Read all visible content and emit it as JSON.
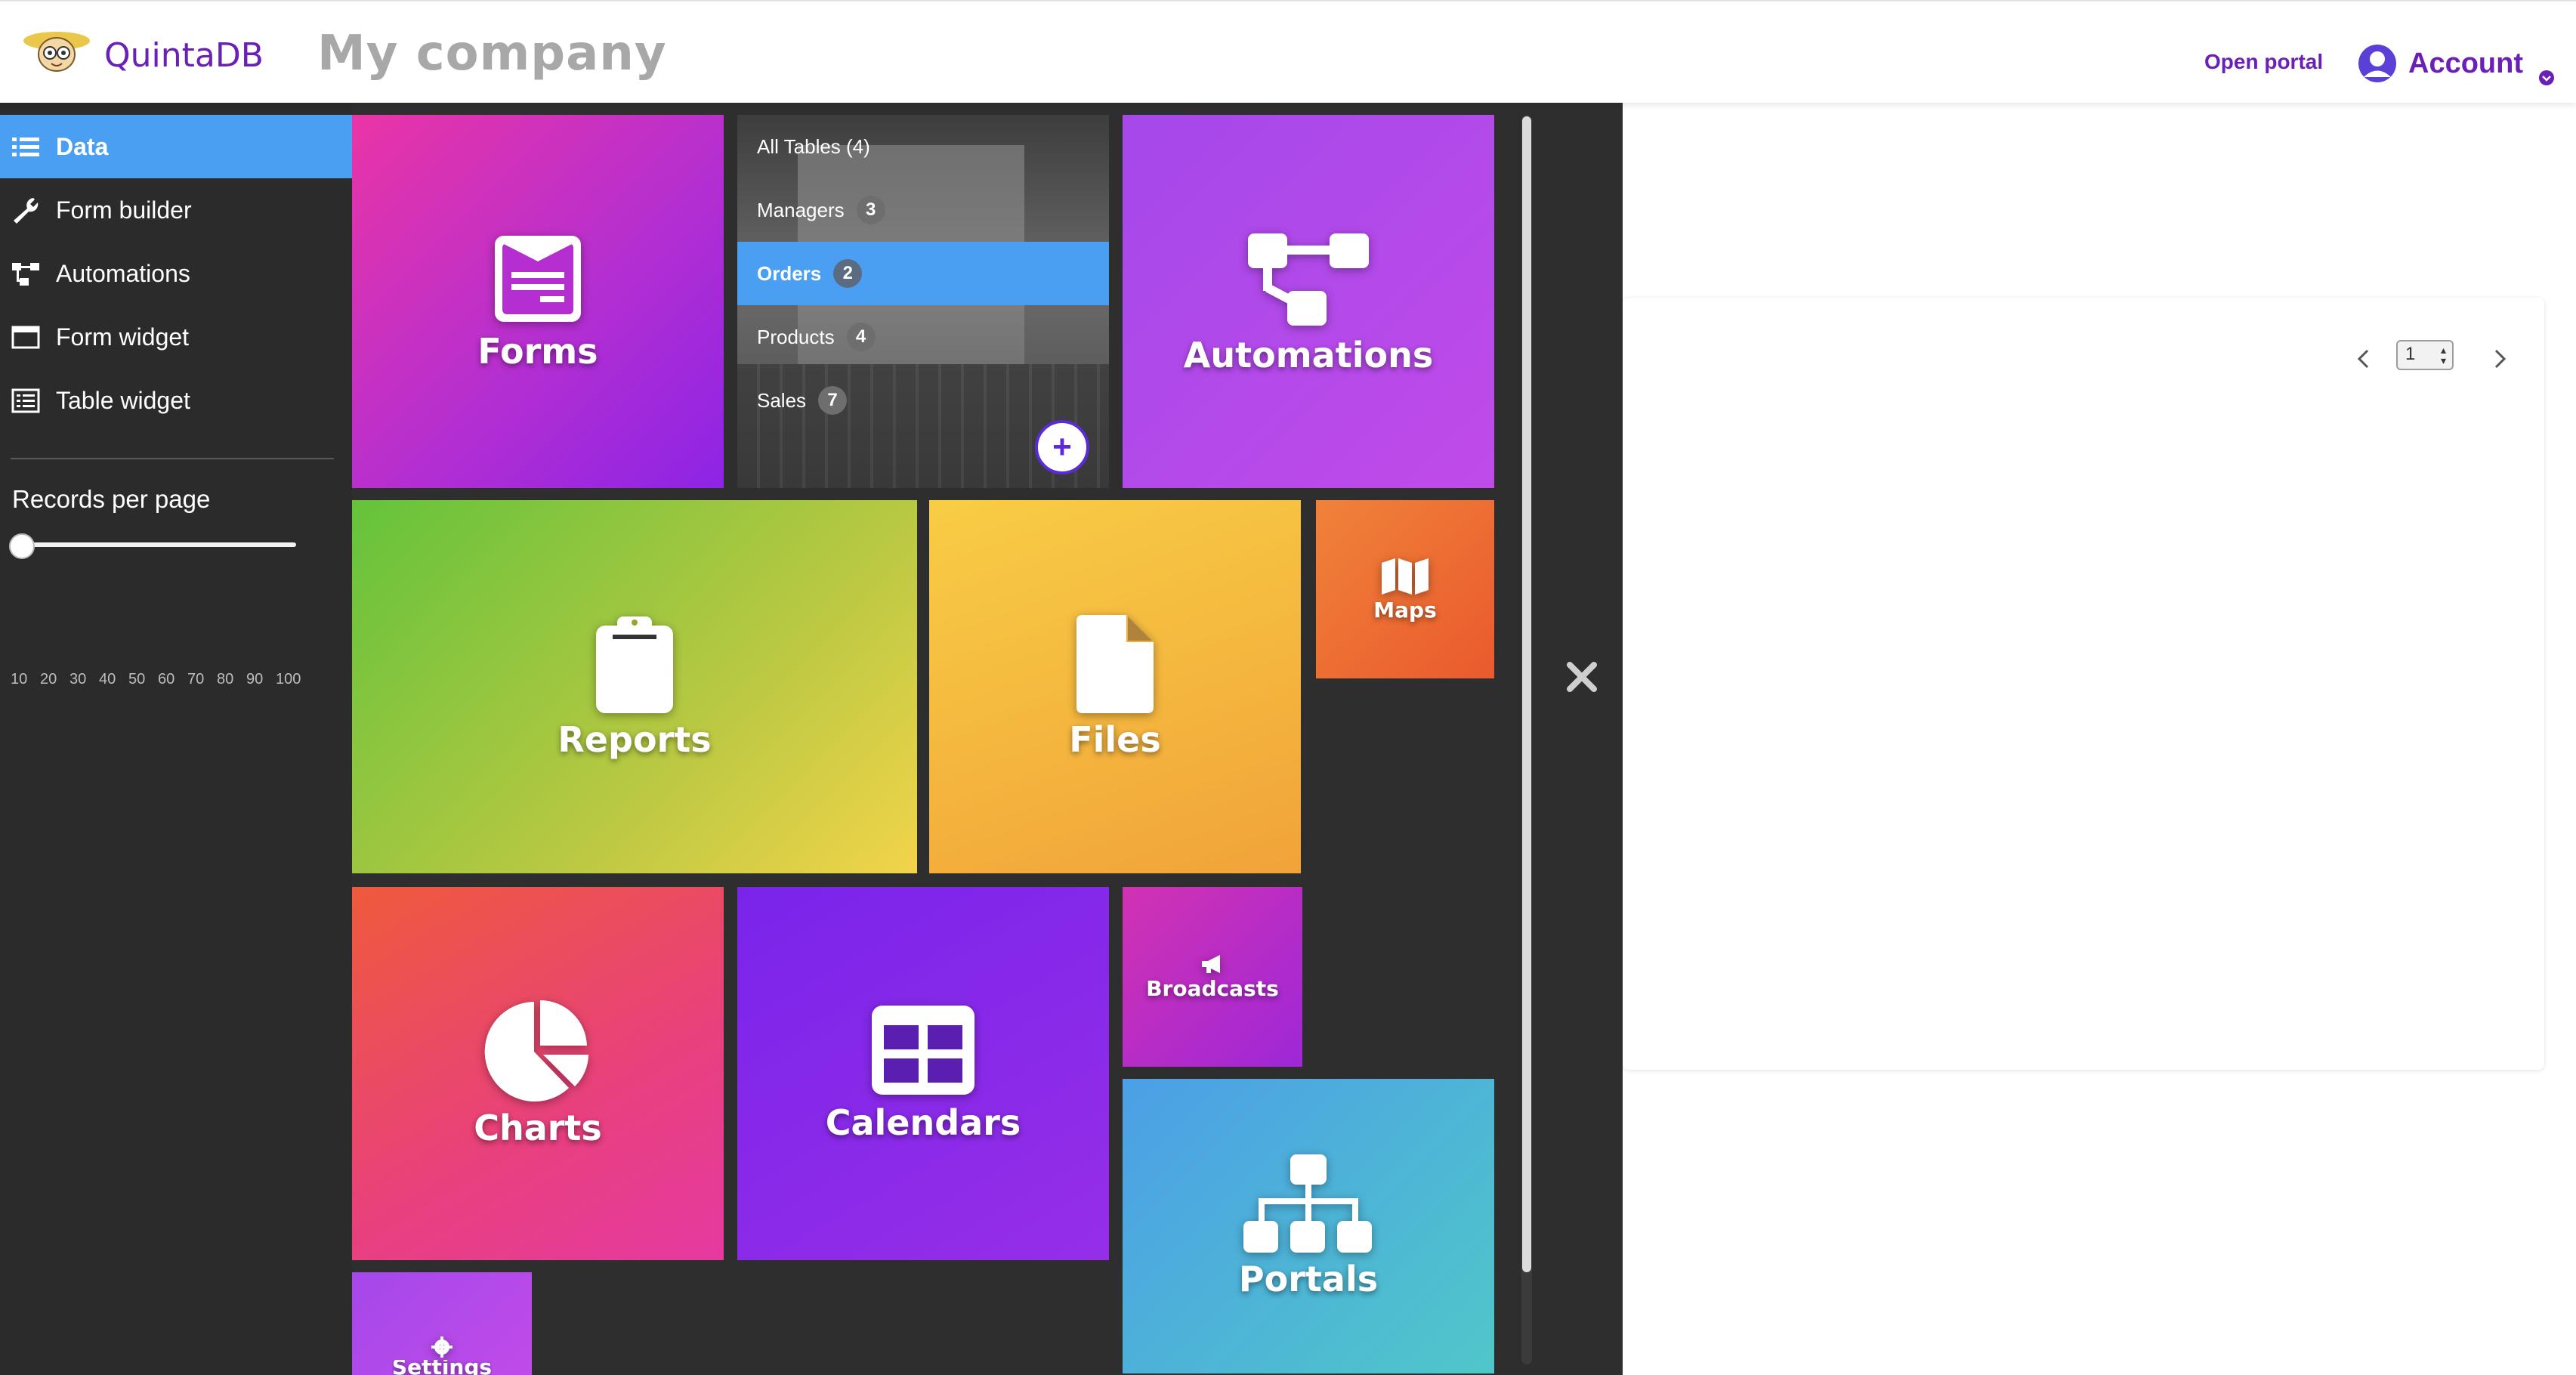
{
  "header": {
    "brand": "QuintaDB",
    "company": "My company",
    "open_portal": "Open portal",
    "account": "Account"
  },
  "sidebar": {
    "items": [
      {
        "label": "Data",
        "icon": "list-icon",
        "active": true
      },
      {
        "label": "Form builder",
        "icon": "wrench-icon",
        "active": false
      },
      {
        "label": "Automations",
        "icon": "sitemap-icon",
        "active": false
      },
      {
        "label": "Form widget",
        "icon": "window-icon",
        "active": false
      },
      {
        "label": "Table widget",
        "icon": "table-list-icon",
        "active": false
      }
    ],
    "records_per_page": {
      "title": "Records per page",
      "ticks": [
        "10",
        "20",
        "30",
        "40",
        "50",
        "60",
        "70",
        "80",
        "90",
        "100"
      ],
      "value": 10
    }
  },
  "tiles": {
    "forms": "Forms",
    "automations": "Automations",
    "reports": "Reports",
    "files": "Files",
    "maps": "Maps",
    "charts": "Charts",
    "calendars": "Calendars",
    "broadcasts": "Broadcasts",
    "portals": "Portals",
    "settings": "Settings"
  },
  "tables": {
    "header": "All Tables (4)",
    "rows": [
      {
        "name": "Managers",
        "count": "3",
        "active": false
      },
      {
        "name": "Orders",
        "count": "2",
        "active": true
      },
      {
        "name": "Products",
        "count": "4",
        "active": false
      },
      {
        "name": "Sales",
        "count": "7",
        "active": false
      }
    ],
    "add_label": "+"
  },
  "pager": {
    "current_page": "1"
  },
  "colors": {
    "brand": "#6a1fb8",
    "active_blue": "#4a9ff2",
    "panel_dark": "#2e2e2e",
    "sidebar_dark": "#2b2b2b"
  }
}
